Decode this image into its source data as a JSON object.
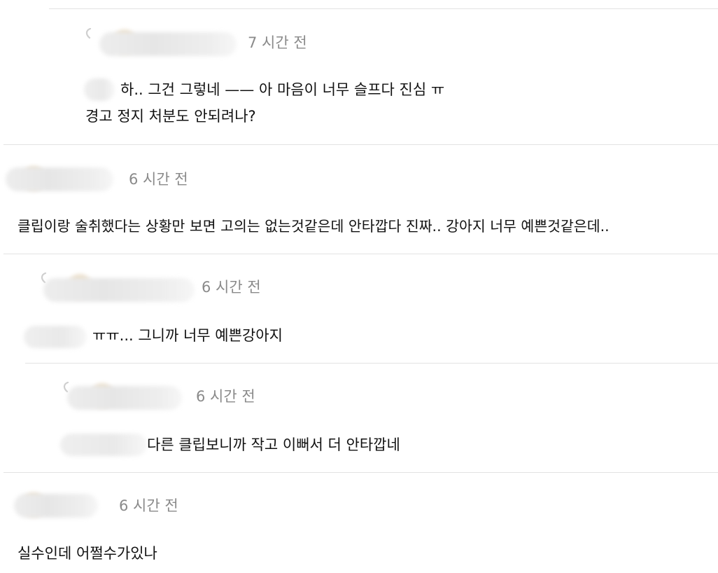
{
  "comments": [
    {
      "time": "7 시간 전",
      "line1": "하.. 그건 그렇네 —— 아 마음이 너무 슬프다 진심 ㅠ",
      "line2": "경고 정지 처분도 안되려나?",
      "avatar_icon": "user-avatar-icon",
      "reply_icon": "reply-arrow-icon"
    },
    {
      "time": "6 시간 전",
      "line1": "클립이랑 술취했다는 상황만 보면 고의는 없는것같은데 안타깝다 진짜.. 강아지 너무 예쁜것같은데..",
      "avatar_icon": "user-avatar-icon"
    },
    {
      "time": "6 시간 전",
      "line1": "ㅠㅠ... 그니까 너무 예쁜강아지",
      "avatar_icon": "user-avatar-icon",
      "reply_icon": "reply-arrow-icon"
    },
    {
      "time": "6 시간 전",
      "line1": "다른 클립보니까 작고 이뻐서 더 안타깝네",
      "avatar_icon": "user-avatar-icon",
      "reply_icon": "reply-arrow-icon"
    },
    {
      "time": "6 시간 전",
      "line1": "실수인데 어쩔수가있나",
      "avatar_icon": "user-avatar-icon"
    }
  ],
  "colors": {
    "divider": "#e3e3e3",
    "timestamp": "#8a8a8a",
    "text": "#111111"
  }
}
